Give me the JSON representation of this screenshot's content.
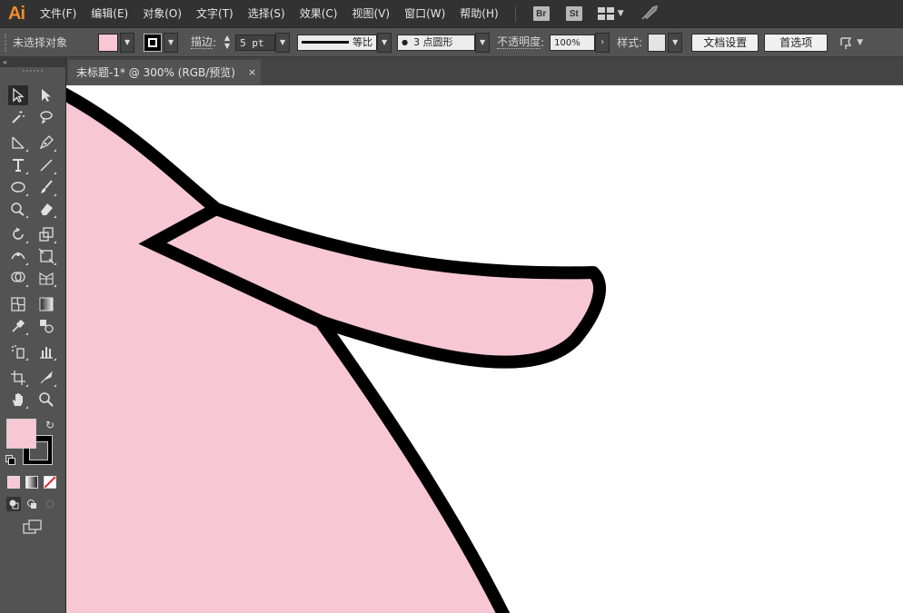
{
  "app": {
    "logo": "Ai"
  },
  "menu": {
    "items": [
      "文件(F)",
      "编辑(E)",
      "对象(O)",
      "文字(T)",
      "选择(S)",
      "效果(C)",
      "视图(V)",
      "窗口(W)",
      "帮助(H)"
    ],
    "bridge": "Br",
    "stock": "St"
  },
  "control": {
    "selection_status": "未选择对象",
    "fill_color": "#f7c7d4",
    "stroke_label": "描边",
    "stroke_weight": "5 pt",
    "profile_label": "等比",
    "brush_label": "3 点圆形",
    "opacity_label": "不透明度",
    "opacity_value": "100%",
    "style_label": "样式",
    "doc_setup_button": "文档设置",
    "preferences_button": "首选项"
  },
  "document": {
    "tab_title": "未标题-1* @ 300% (RGB/预览)",
    "tab_close": "×"
  },
  "artwork": {
    "fill": "#f7c7d4",
    "stroke": "#000000"
  },
  "toolbox": {
    "fill_color": "#f7c7d4",
    "stroke_color": "#000000"
  }
}
